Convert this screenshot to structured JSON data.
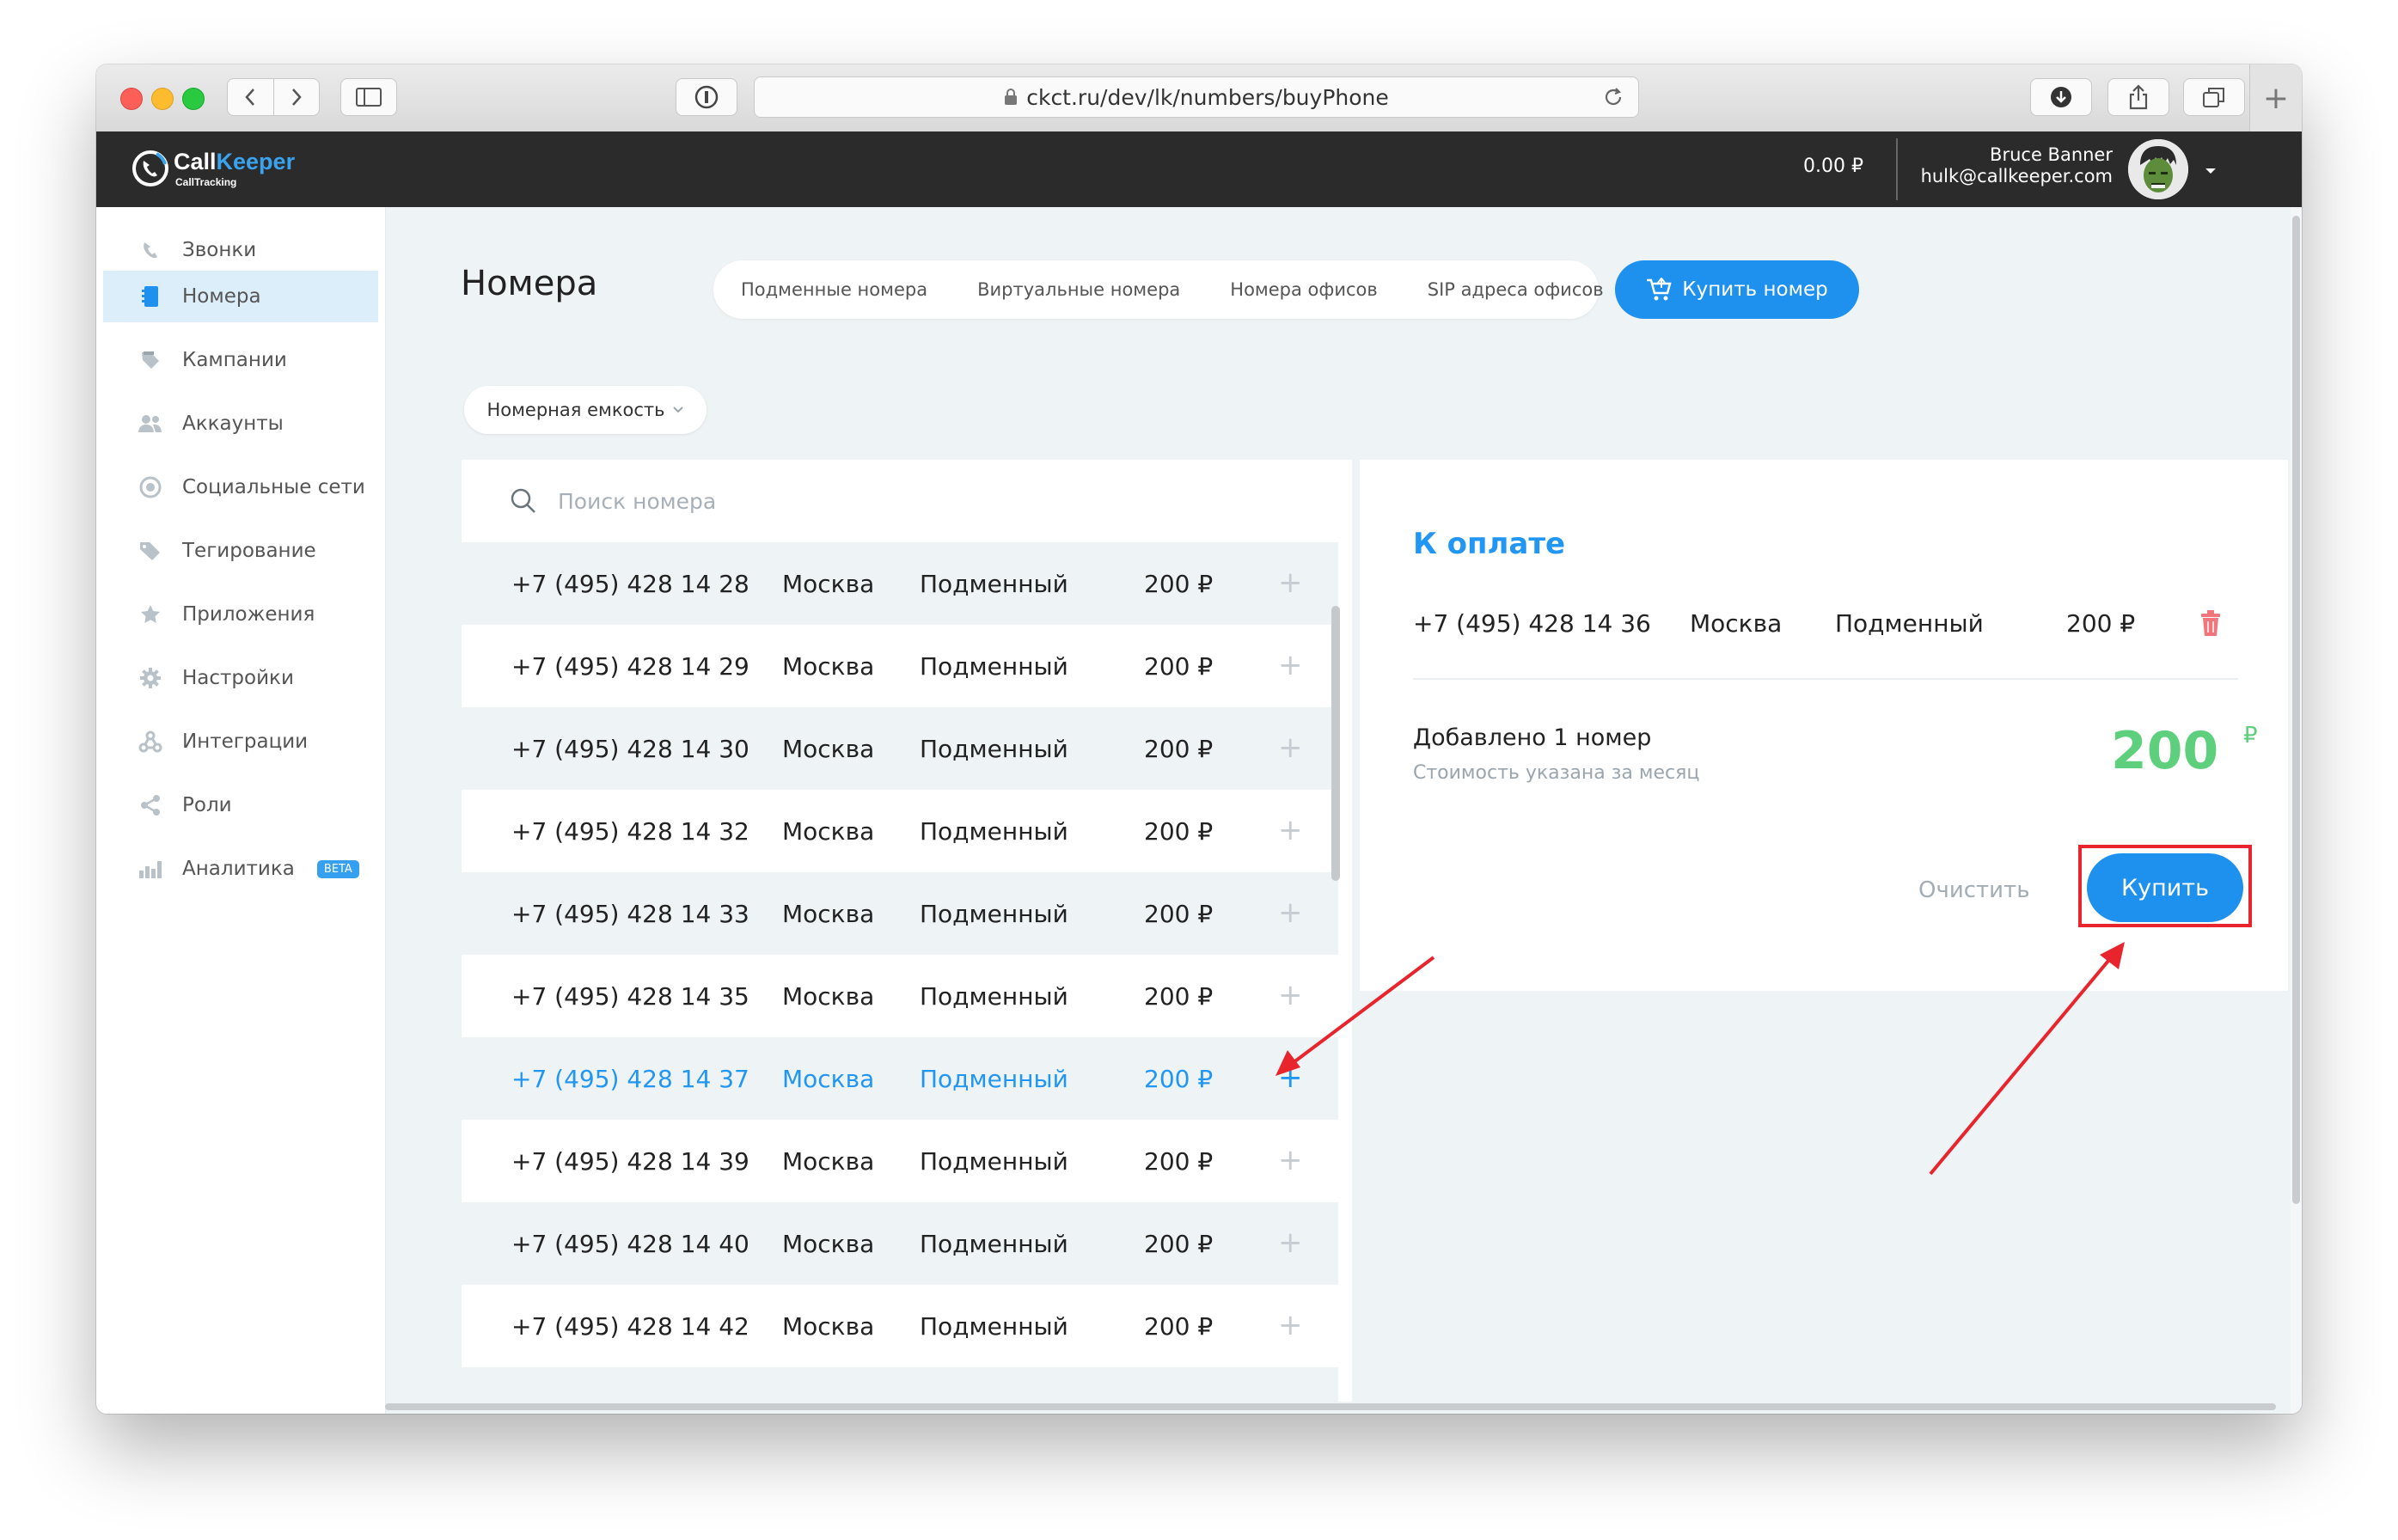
{
  "browser": {
    "url": "ckct.ru/dev/lk/numbers/buyPhone"
  },
  "header": {
    "logo_name_white": "Call",
    "logo_name_blue": "Keeper",
    "logo_sub": "CallTracking",
    "balance": "0.00 ₽",
    "user_name": "Bruce Banner",
    "user_email": "hulk@callkeeper.com"
  },
  "sidebar": {
    "items": [
      {
        "label": "Звонки",
        "icon": "phone-icon"
      },
      {
        "label": "Номера",
        "icon": "notebook-icon"
      },
      {
        "label": "Кампании",
        "icon": "campaign-icon"
      },
      {
        "label": "Аккаунты",
        "icon": "users-icon"
      },
      {
        "label": "Социальные сети",
        "icon": "globe-icon"
      },
      {
        "label": "Тегирование",
        "icon": "tags-icon"
      },
      {
        "label": "Приложения",
        "icon": "star-icon"
      },
      {
        "label": "Настройки",
        "icon": "gear-icon"
      },
      {
        "label": "Интеграции",
        "icon": "integration-icon"
      },
      {
        "label": "Роли",
        "icon": "share-icon"
      },
      {
        "label": "Аналитика",
        "icon": "bar-chart-icon",
        "badge": "BETA"
      }
    ]
  },
  "main": {
    "title": "Номера",
    "tabs": [
      "Подменные номера",
      "Виртуальные номера",
      "Номера офисов",
      "SIP адреса офисов"
    ],
    "buy_button": "Купить номер",
    "filter_label": "Номерная емкость",
    "search_placeholder": "Поиск номера"
  },
  "numbers": [
    {
      "phone": "+7 (495) 428 14 28",
      "city": "Москва",
      "type": "Подменный",
      "price": "200 ₽",
      "action": "+"
    },
    {
      "phone": "+7 (495) 428 14 29",
      "city": "Москва",
      "type": "Подменный",
      "price": "200 ₽",
      "action": "+"
    },
    {
      "phone": "+7 (495) 428 14 30",
      "city": "Москва",
      "type": "Подменный",
      "price": "200 ₽",
      "action": "+"
    },
    {
      "phone": "+7 (495) 428 14 32",
      "city": "Москва",
      "type": "Подменный",
      "price": "200 ₽",
      "action": "+"
    },
    {
      "phone": "+7 (495) 428 14 33",
      "city": "Москва",
      "type": "Подменный",
      "price": "200 ₽",
      "action": "+"
    },
    {
      "phone": "+7 (495) 428 14 35",
      "city": "Москва",
      "type": "Подменный",
      "price": "200 ₽",
      "action": "+"
    },
    {
      "phone": "+7 (495) 428 14 37",
      "city": "Москва",
      "type": "Подменный",
      "price": "200 ₽",
      "action": "+"
    },
    {
      "phone": "+7 (495) 428 14 39",
      "city": "Москва",
      "type": "Подменный",
      "price": "200 ₽",
      "action": "+"
    },
    {
      "phone": "+7 (495) 428 14 40",
      "city": "Москва",
      "type": "Подменный",
      "price": "200 ₽",
      "action": "+"
    },
    {
      "phone": "+7 (495) 428 14 42",
      "city": "Москва",
      "type": "Подменный",
      "price": "200 ₽",
      "action": "+"
    }
  ],
  "payment": {
    "title": "К оплате",
    "item": {
      "phone": "+7 (495) 428 14 36",
      "city": "Москва",
      "type": "Подменный",
      "price": "200 ₽"
    },
    "added_text": "Добавлено 1 номер",
    "note": "Стоимость указана за месяц",
    "total": "200",
    "currency": "₽",
    "clear_label": "Очистить",
    "buy_label": "Купить"
  },
  "colors": {
    "accent": "#1e90ee",
    "total_green": "#5ecf7d",
    "annotation_red": "#e8252c"
  }
}
